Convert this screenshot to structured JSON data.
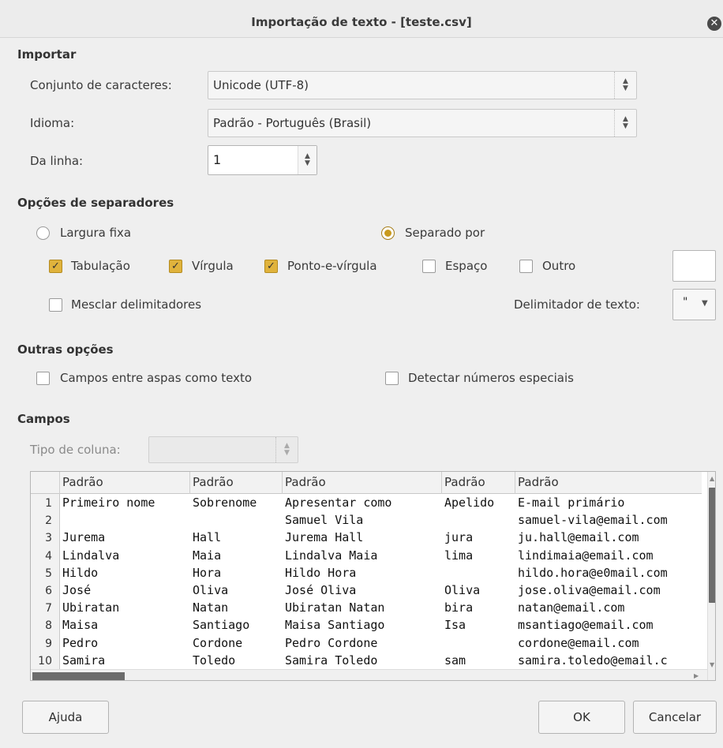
{
  "window": {
    "title": "Importação de texto - [teste.csv]"
  },
  "importar": {
    "section": "Importar",
    "charset_label": "Conjunto de caracteres:",
    "charset_value": "Unicode (UTF-8)",
    "language_label": "Idioma:",
    "language_value": "Padrão - Português (Brasil)",
    "fromrow_label": "Da linha:",
    "fromrow_value": "1"
  },
  "separators": {
    "section": "Opções de separadores",
    "fixed_width": "Largura fixa",
    "separated_by": "Separado por",
    "tab": "Tabulação",
    "comma": "Vírgula",
    "semicolon": "Ponto-e-vírgula",
    "space": "Espaço",
    "other": "Outro",
    "merge": "Mesclar delimitadores",
    "text_delim_label": "Delimitador de texto:",
    "text_delim_value": "\"",
    "state": {
      "fixed_width": false,
      "separated_by": true,
      "tab": true,
      "comma": true,
      "semicolon": true,
      "space": false,
      "other": false,
      "merge": false
    }
  },
  "other_options": {
    "section": "Outras opções",
    "quoted_as_text": "Campos entre aspas como texto",
    "detect_special": "Detectar números especiais"
  },
  "fields": {
    "section": "Campos",
    "column_type_label": "Tipo de coluna:",
    "columns": [
      "Padrão",
      "Padrão",
      "Padrão",
      "Padrão",
      "Padrão"
    ],
    "rows": [
      [
        "1",
        "Primeiro nome",
        "Sobrenome",
        "Apresentar como",
        "Apelido",
        "E-mail primário"
      ],
      [
        "2",
        "",
        "",
        "Samuel Vila",
        "",
        "samuel-vila@email.com"
      ],
      [
        "3",
        "Jurema",
        "Hall",
        "Jurema Hall",
        "jura",
        "ju.hall@email.com"
      ],
      [
        "4",
        "Lindalva",
        "Maia",
        "Lindalva Maia",
        "lima",
        "lindimaia@email.com"
      ],
      [
        "5",
        "Hildo",
        "Hora",
        "Hildo Hora",
        "",
        "hildo.hora@e0mail.com"
      ],
      [
        "6",
        "José",
        "Oliva",
        "José Oliva",
        "Oliva",
        "jose.oliva@email.com"
      ],
      [
        "7",
        "Ubiratan",
        "Natan",
        "Ubiratan Natan",
        "bira",
        "natan@email.com"
      ],
      [
        "8",
        "Maisa",
        "Santiago",
        "Maisa Santiago",
        "Isa",
        "msantiago@email.com"
      ],
      [
        "9",
        "Pedro",
        "Cordone",
        "Pedro Cordone",
        "",
        "cordone@email.com"
      ],
      [
        "10",
        "Samira",
        "Toledo",
        "Samira Toledo",
        "sam",
        "samira.toledo@email.c"
      ]
    ]
  },
  "buttons": {
    "help": "Ajuda",
    "ok": "OK",
    "cancel": "Cancelar"
  }
}
